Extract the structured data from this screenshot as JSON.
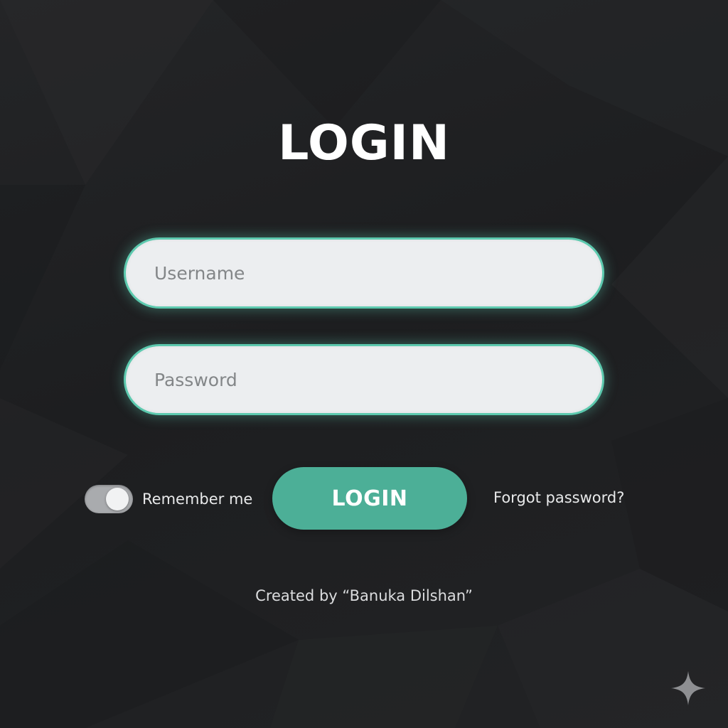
{
  "header": {
    "title": "LOGIN"
  },
  "form": {
    "username": {
      "placeholder": "Username",
      "value": ""
    },
    "password": {
      "placeholder": "Password",
      "value": ""
    },
    "remember": {
      "label": "Remember me",
      "checked": true
    },
    "submit_label": "LOGIN",
    "forgot_label": "Forgot password?"
  },
  "footer": {
    "credit": "Created by “Banuka Dilshan”"
  },
  "icons": {
    "corner": "sparkle-icon"
  },
  "colors": {
    "background": "#1f2022",
    "accent": "#4caf97",
    "field_border": "#5cc9ae",
    "field_bg": "#eceef0",
    "text": "#ffffff"
  }
}
